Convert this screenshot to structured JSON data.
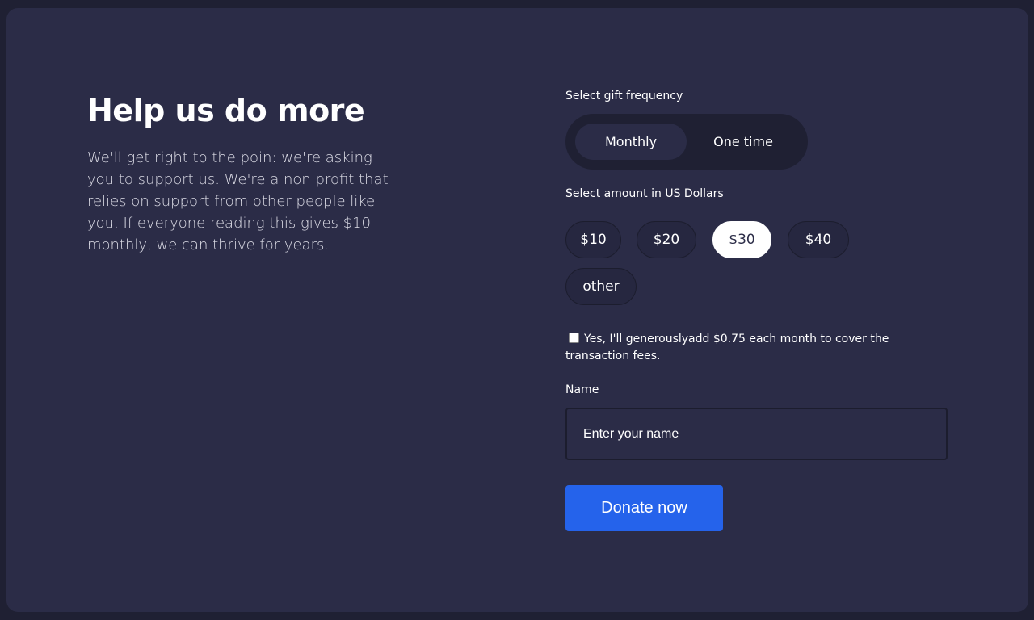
{
  "intro": {
    "heading": "Help us do more",
    "body": "We'll get right to the poin: we're asking you to support us. We're a non profit that relies on support from other people like you. If everyone reading this gives $10 monthly, we can thrive for years."
  },
  "frequency": {
    "label": "Select gift frequency",
    "options": [
      "Monthly",
      "One time"
    ],
    "selected": "Monthly"
  },
  "amount": {
    "label": "Select amount in US Dollars",
    "options": [
      "$10",
      "$20",
      "$30",
      "$40",
      "other"
    ],
    "selected": "$30"
  },
  "fee": {
    "checked": false,
    "text": "Yes, I'll generouslyadd $0.75 each month to cover the transaction fees."
  },
  "name": {
    "label": "Name",
    "placeholder": "Enter your name",
    "value": ""
  },
  "donate": {
    "label": "Donate now"
  },
  "colors": {
    "page_background": "#1f2033",
    "card_background": "#2b2c47",
    "accent": "#2563eb",
    "selected_amount": "#ffffff"
  }
}
